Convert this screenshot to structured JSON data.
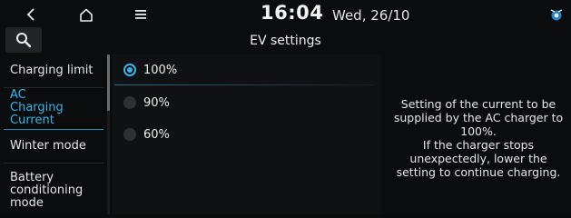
{
  "status_bar": {
    "time": "16:04",
    "date": "Wed, 26/10",
    "icons": [
      "back-icon",
      "home-icon",
      "menu-icon",
      "connectivity-icon"
    ]
  },
  "header": {
    "title": "EV settings",
    "search_icon": "search-icon"
  },
  "sidebar": {
    "items": [
      {
        "label": "Charging limit",
        "active": false
      },
      {
        "label": "AC Charging Current",
        "active": true
      },
      {
        "label": "Winter mode",
        "active": false
      },
      {
        "label": "Battery conditioning mode",
        "active": false
      }
    ]
  },
  "options": {
    "items": [
      {
        "label": "100%",
        "selected": true
      },
      {
        "label": "90%",
        "selected": false
      },
      {
        "label": "60%",
        "selected": false
      }
    ]
  },
  "description": "Setting of the current to be supplied by the AC charger to 100%.\nIf the charger stops unexpectedly, lower the setting to continue charging.",
  "colors": {
    "accent": "#3ab3e6",
    "background": "#0b0c0e"
  }
}
